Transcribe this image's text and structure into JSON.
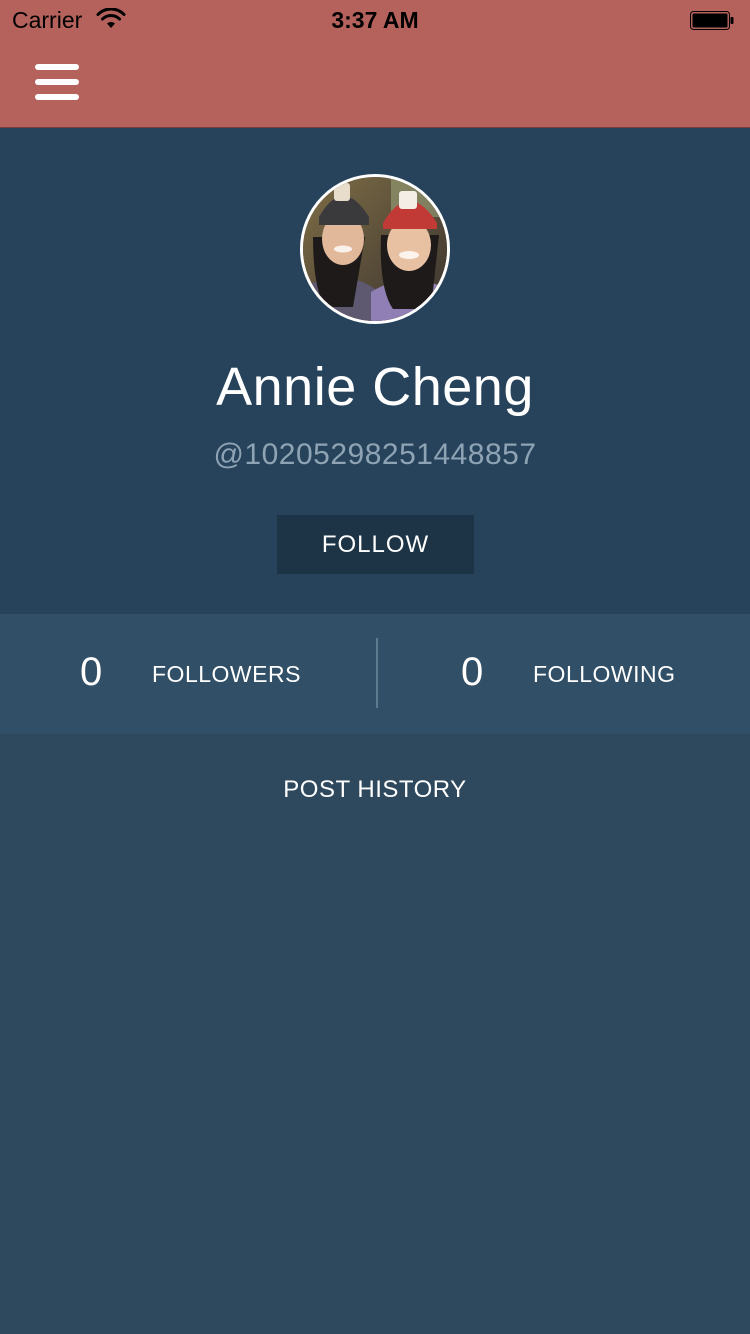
{
  "status_bar": {
    "carrier": "Carrier",
    "time": "3:37 AM",
    "icons": [
      "wifi-icon",
      "battery-icon"
    ]
  },
  "nav": {
    "menu_icon": "hamburger-menu-icon"
  },
  "colors": {
    "nav_bar": "#b5625d",
    "header_bg": "#26435b",
    "stats_bg": "#314f66",
    "content_bg": "#2e495d",
    "follow_button_bg": "#1d3446",
    "handle_text": "#8ea3b4"
  },
  "profile": {
    "avatar": "profile-photo-avatar",
    "name": "Annie Cheng",
    "handle": "@10205298251448857",
    "follow_label": "FOLLOW"
  },
  "stats": {
    "followers_count": "0",
    "followers_label": "FOLLOWERS",
    "following_count": "0",
    "following_label": "FOLLOWING"
  },
  "post_history": {
    "title": "POST HISTORY",
    "items": []
  }
}
